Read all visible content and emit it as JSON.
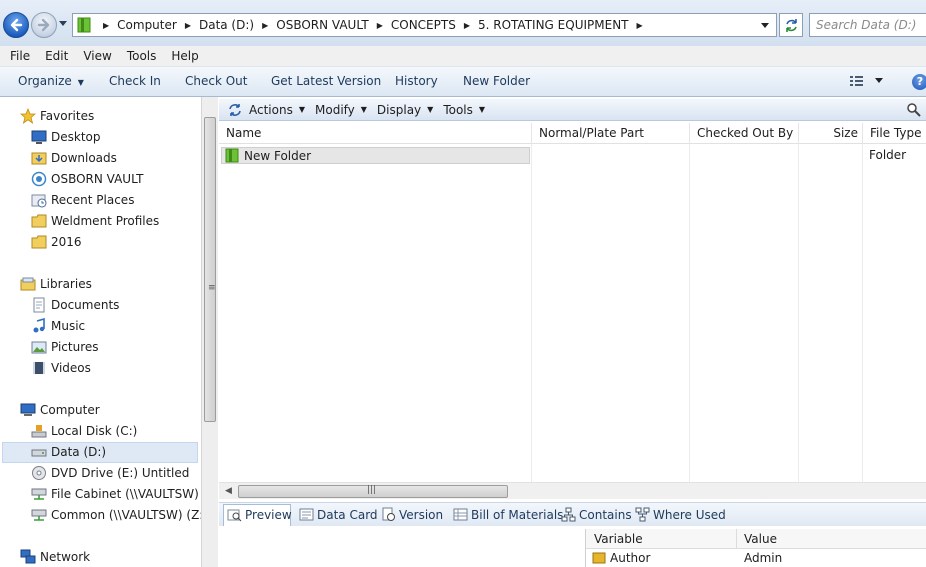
{
  "address_bar": {
    "breadcrumbs": [
      "Computer",
      "Data (D:)",
      "OSBORN VAULT",
      "CONCEPTS",
      "5. ROTATING EQUIPMENT"
    ],
    "search_placeholder": "Search Data (D:)"
  },
  "menu": [
    "File",
    "Edit",
    "View",
    "Tools",
    "Help"
  ],
  "command_bar": {
    "organize": "Organize",
    "check_in": "Check In",
    "check_out": "Check Out",
    "get_latest": "Get Latest Version",
    "history": "History",
    "new_folder": "New Folder"
  },
  "nav": {
    "favorites": {
      "label": "Favorites",
      "items": [
        "Desktop",
        "Downloads",
        "OSBORN VAULT",
        "Recent Places",
        "Weldment Profiles",
        "2016"
      ]
    },
    "libraries": {
      "label": "Libraries",
      "items": [
        "Documents",
        "Music",
        "Pictures",
        "Videos"
      ]
    },
    "computer": {
      "label": "Computer",
      "items": [
        "Local Disk (C:)",
        "Data (D:)",
        "DVD Drive (E:) Untitled",
        "File Cabinet (\\\\VAULTSW) (Y",
        "Common (\\\\VAULTSW) (Z:)"
      ]
    },
    "network": {
      "label": "Network"
    }
  },
  "vault_toolbar": {
    "actions": "Actions",
    "modify": "Modify",
    "display": "Display",
    "tools": "Tools"
  },
  "columns": [
    "Name",
    "Normal/Plate Part",
    "Checked Out By",
    "Size",
    "File Type"
  ],
  "rows": [
    {
      "name": "New Folder",
      "file_type": "Folder"
    }
  ],
  "tabs": [
    "Preview",
    "Data Card",
    "Version",
    "Bill of Materials",
    "Contains",
    "Where Used"
  ],
  "variables": {
    "headers": [
      "Variable",
      "Value"
    ],
    "rows": [
      {
        "variable": "Author",
        "value": "Admin"
      }
    ]
  },
  "colors": {
    "accent": "#1e5fbf",
    "folder_green": "#5db82e",
    "selection": "#dfe9f6"
  }
}
